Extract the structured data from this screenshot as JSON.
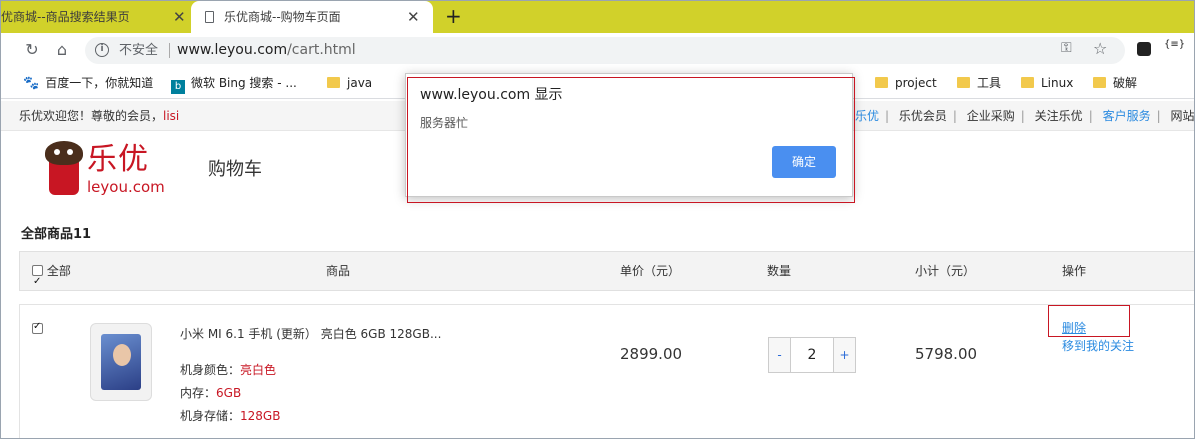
{
  "browser": {
    "tabs": [
      {
        "title": "优商城--商品搜索结果页",
        "active": false
      },
      {
        "title": "乐优商城--购物车页面",
        "active": true
      }
    ],
    "tab_close": "✕",
    "new_tab": "+",
    "security_label": "不安全",
    "url_host": "www.leyou.com",
    "url_path": "/cart.html",
    "accent_color": "#d1d12a"
  },
  "bookmarks": [
    {
      "label": "百度一下，你就知道",
      "icon": "paw-icon"
    },
    {
      "label": "微软 Bing 搜索 - ...",
      "icon": "bing-icon"
    },
    {
      "label": "java",
      "icon": "folder-icon"
    },
    {
      "label": "project",
      "icon": "folder-icon"
    },
    {
      "label": "工具",
      "icon": "folder-icon"
    },
    {
      "label": "Linux",
      "icon": "folder-icon"
    },
    {
      "label": "破解",
      "icon": "folder-icon"
    }
  ],
  "site": {
    "welcome": "乐优欢迎您！尊敬的会员，",
    "username": "lisi",
    "top_links": [
      "乐优",
      "乐优会员",
      "企业采购",
      "关注乐优",
      "客户服务",
      "网站"
    ],
    "logo_cn": "乐优",
    "logo_en": "leyou.com",
    "page_title": "购物车",
    "brand_color": "#c81623"
  },
  "cart": {
    "count_label": "全部商品11",
    "headers": {
      "select_all": "全部",
      "product": "商品",
      "unit_price": "单价（元）",
      "quantity": "数量",
      "subtotal": "小计（元）",
      "action": "操作"
    },
    "item": {
      "name": "小米 MI 6.1 手机 (更新） 亮白色 6GB 128GB...",
      "attrs": [
        {
          "key": "机身颜色：",
          "value": "亮白色"
        },
        {
          "key": "内存：",
          "value": "6GB"
        },
        {
          "key": "机身存储：",
          "value": "128GB"
        }
      ],
      "price": "2899.00",
      "qty": "2",
      "minus": "-",
      "plus": "+",
      "subtotal": "5798.00",
      "delete_label": "删除",
      "favorite_label": "移到我的关注"
    }
  },
  "dialog": {
    "title": "www.leyou.com 显示",
    "message": "服务器忙",
    "ok_label": "确定"
  }
}
